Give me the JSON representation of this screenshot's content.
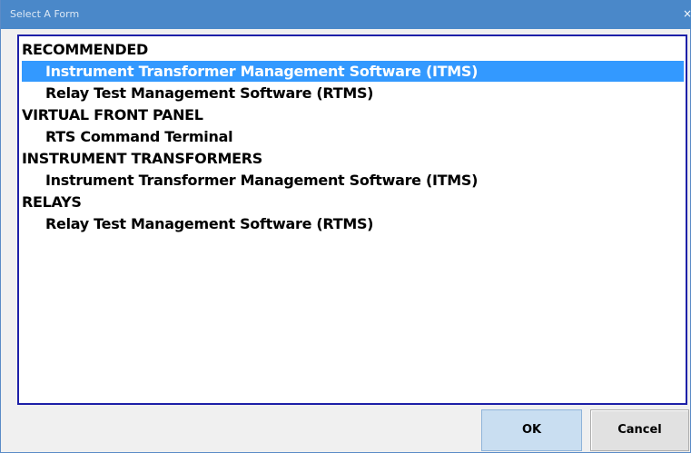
{
  "window": {
    "title": "Select A Form",
    "close_glyph": "×"
  },
  "list": {
    "rows": [
      {
        "kind": "header",
        "label": "RECOMMENDED"
      },
      {
        "kind": "item",
        "label": "Instrument Transformer Management Software (ITMS)",
        "selected": true
      },
      {
        "kind": "item",
        "label": "Relay Test Management Software (RTMS)",
        "selected": false
      },
      {
        "kind": "header",
        "label": "VIRTUAL FRONT PANEL"
      },
      {
        "kind": "item",
        "label": "RTS Command Terminal",
        "selected": false
      },
      {
        "kind": "header",
        "label": "INSTRUMENT TRANSFORMERS"
      },
      {
        "kind": "item",
        "label": "Instrument Transformer Management Software (ITMS)",
        "selected": false
      },
      {
        "kind": "header",
        "label": "RELAYS"
      },
      {
        "kind": "item",
        "label": "Relay Test Management Software (RTMS)",
        "selected": false
      }
    ]
  },
  "buttons": {
    "ok_label": "OK",
    "cancel_label": "Cancel"
  },
  "colors": {
    "titlebar": "#4a88c9",
    "selection": "#3399ff",
    "list_border": "#1d20a8"
  }
}
